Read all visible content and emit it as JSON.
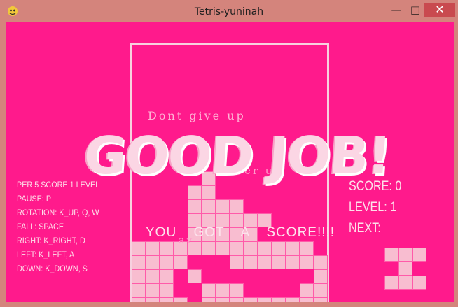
{
  "window": {
    "title": "Tetris-yuninah",
    "minimize": "—",
    "maximize": "□",
    "close": "✕"
  },
  "colors": {
    "background": "#ff1a8c",
    "block": "#f8bdd0",
    "text": "#fde0ea"
  },
  "game": {
    "faint_text_1": "Dont give up",
    "faint_text_2": "cheer up",
    "faint_text_3": "av",
    "overlay_banner": "GOOD JOB!",
    "score_message": "YOU GOT A SCORE!!!!"
  },
  "controls": [
    "PER 5 SCORE 1 LEVEL",
    "PAUSE: P",
    "ROTATION: K_UP, Q, W",
    "FALL: SPACE",
    "RIGHT: K_RIGHT, D",
    "LEFT: K_LEFT, A",
    "DOWN: K_DOWN, S"
  ],
  "stats": {
    "score": "SCORE: 0",
    "level": "LEVEL: 1",
    "next": "NEXT:"
  }
}
